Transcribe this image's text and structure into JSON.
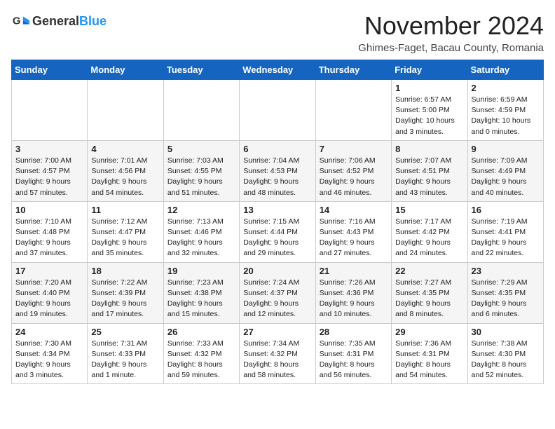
{
  "header": {
    "logo_general": "General",
    "logo_blue": "Blue",
    "month_title": "November 2024",
    "subtitle": "Ghimes-Faget, Bacau County, Romania"
  },
  "days_of_week": [
    "Sunday",
    "Monday",
    "Tuesday",
    "Wednesday",
    "Thursday",
    "Friday",
    "Saturday"
  ],
  "weeks": [
    [
      {
        "day": "",
        "info": ""
      },
      {
        "day": "",
        "info": ""
      },
      {
        "day": "",
        "info": ""
      },
      {
        "day": "",
        "info": ""
      },
      {
        "day": "",
        "info": ""
      },
      {
        "day": "1",
        "info": "Sunrise: 6:57 AM\nSunset: 5:00 PM\nDaylight: 10 hours\nand 3 minutes."
      },
      {
        "day": "2",
        "info": "Sunrise: 6:59 AM\nSunset: 4:59 PM\nDaylight: 10 hours\nand 0 minutes."
      }
    ],
    [
      {
        "day": "3",
        "info": "Sunrise: 7:00 AM\nSunset: 4:57 PM\nDaylight: 9 hours\nand 57 minutes."
      },
      {
        "day": "4",
        "info": "Sunrise: 7:01 AM\nSunset: 4:56 PM\nDaylight: 9 hours\nand 54 minutes."
      },
      {
        "day": "5",
        "info": "Sunrise: 7:03 AM\nSunset: 4:55 PM\nDaylight: 9 hours\nand 51 minutes."
      },
      {
        "day": "6",
        "info": "Sunrise: 7:04 AM\nSunset: 4:53 PM\nDaylight: 9 hours\nand 48 minutes."
      },
      {
        "day": "7",
        "info": "Sunrise: 7:06 AM\nSunset: 4:52 PM\nDaylight: 9 hours\nand 46 minutes."
      },
      {
        "day": "8",
        "info": "Sunrise: 7:07 AM\nSunset: 4:51 PM\nDaylight: 9 hours\nand 43 minutes."
      },
      {
        "day": "9",
        "info": "Sunrise: 7:09 AM\nSunset: 4:49 PM\nDaylight: 9 hours\nand 40 minutes."
      }
    ],
    [
      {
        "day": "10",
        "info": "Sunrise: 7:10 AM\nSunset: 4:48 PM\nDaylight: 9 hours\nand 37 minutes."
      },
      {
        "day": "11",
        "info": "Sunrise: 7:12 AM\nSunset: 4:47 PM\nDaylight: 9 hours\nand 35 minutes."
      },
      {
        "day": "12",
        "info": "Sunrise: 7:13 AM\nSunset: 4:46 PM\nDaylight: 9 hours\nand 32 minutes."
      },
      {
        "day": "13",
        "info": "Sunrise: 7:15 AM\nSunset: 4:44 PM\nDaylight: 9 hours\nand 29 minutes."
      },
      {
        "day": "14",
        "info": "Sunrise: 7:16 AM\nSunset: 4:43 PM\nDaylight: 9 hours\nand 27 minutes."
      },
      {
        "day": "15",
        "info": "Sunrise: 7:17 AM\nSunset: 4:42 PM\nDaylight: 9 hours\nand 24 minutes."
      },
      {
        "day": "16",
        "info": "Sunrise: 7:19 AM\nSunset: 4:41 PM\nDaylight: 9 hours\nand 22 minutes."
      }
    ],
    [
      {
        "day": "17",
        "info": "Sunrise: 7:20 AM\nSunset: 4:40 PM\nDaylight: 9 hours\nand 19 minutes."
      },
      {
        "day": "18",
        "info": "Sunrise: 7:22 AM\nSunset: 4:39 PM\nDaylight: 9 hours\nand 17 minutes."
      },
      {
        "day": "19",
        "info": "Sunrise: 7:23 AM\nSunset: 4:38 PM\nDaylight: 9 hours\nand 15 minutes."
      },
      {
        "day": "20",
        "info": "Sunrise: 7:24 AM\nSunset: 4:37 PM\nDaylight: 9 hours\nand 12 minutes."
      },
      {
        "day": "21",
        "info": "Sunrise: 7:26 AM\nSunset: 4:36 PM\nDaylight: 9 hours\nand 10 minutes."
      },
      {
        "day": "22",
        "info": "Sunrise: 7:27 AM\nSunset: 4:35 PM\nDaylight: 9 hours\nand 8 minutes."
      },
      {
        "day": "23",
        "info": "Sunrise: 7:29 AM\nSunset: 4:35 PM\nDaylight: 9 hours\nand 6 minutes."
      }
    ],
    [
      {
        "day": "24",
        "info": "Sunrise: 7:30 AM\nSunset: 4:34 PM\nDaylight: 9 hours\nand 3 minutes."
      },
      {
        "day": "25",
        "info": "Sunrise: 7:31 AM\nSunset: 4:33 PM\nDaylight: 9 hours\nand 1 minute."
      },
      {
        "day": "26",
        "info": "Sunrise: 7:33 AM\nSunset: 4:32 PM\nDaylight: 8 hours\nand 59 minutes."
      },
      {
        "day": "27",
        "info": "Sunrise: 7:34 AM\nSunset: 4:32 PM\nDaylight: 8 hours\nand 58 minutes."
      },
      {
        "day": "28",
        "info": "Sunrise: 7:35 AM\nSunset: 4:31 PM\nDaylight: 8 hours\nand 56 minutes."
      },
      {
        "day": "29",
        "info": "Sunrise: 7:36 AM\nSunset: 4:31 PM\nDaylight: 8 hours\nand 54 minutes."
      },
      {
        "day": "30",
        "info": "Sunrise: 7:38 AM\nSunset: 4:30 PM\nDaylight: 8 hours\nand 52 minutes."
      }
    ]
  ]
}
